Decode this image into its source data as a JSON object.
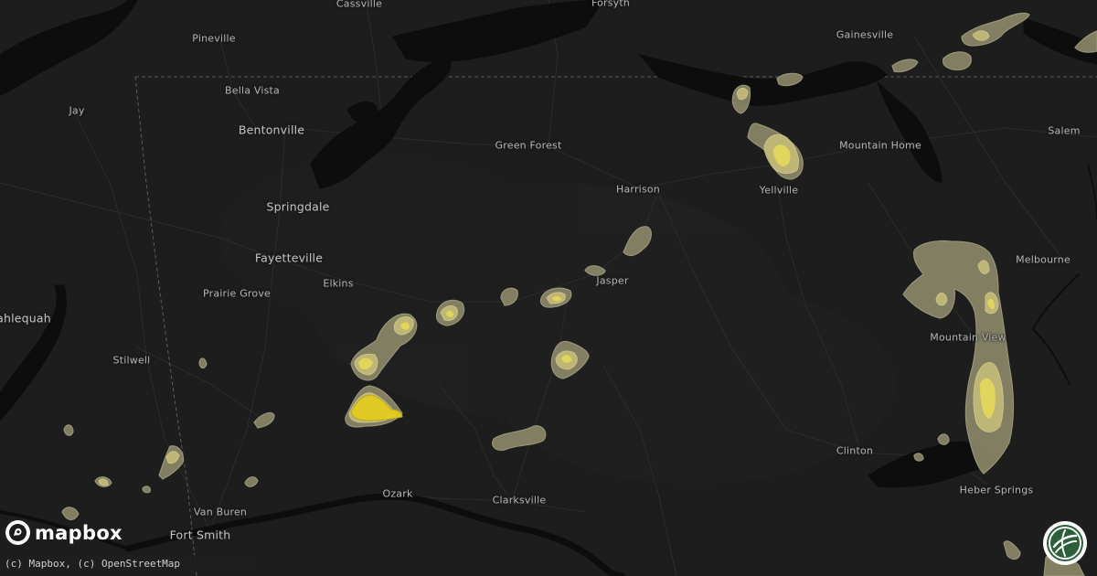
{
  "map": {
    "brand": "mapbox",
    "attribution": "(c) Mapbox, (c) OpenStreetMap",
    "colors": {
      "background": "#1d1d1d",
      "water": "#0c0c0c",
      "roads": "#2b2b2b",
      "border": "#5a5a5a",
      "hail_outer": "#8f8c6c",
      "hail_mid": "#c9c07a",
      "hail_inner": "#e7d85c",
      "hail_core": "#e6cf1e"
    },
    "cities": [
      {
        "id": "cassville",
        "name": "Cassville"
      },
      {
        "id": "forsyth",
        "name": "Forsyth"
      },
      {
        "id": "gainesville",
        "name": "Gainesville"
      },
      {
        "id": "pineville",
        "name": "Pineville"
      },
      {
        "id": "bella-vista",
        "name": "Bella Vista"
      },
      {
        "id": "bentonville",
        "name": "Bentonville"
      },
      {
        "id": "jay",
        "name": "Jay"
      },
      {
        "id": "green-forest",
        "name": "Green Forest"
      },
      {
        "id": "harrison",
        "name": "Harrison"
      },
      {
        "id": "mountain-home",
        "name": "Mountain Home"
      },
      {
        "id": "yellville",
        "name": "Yellville"
      },
      {
        "id": "salem",
        "name": "Salem"
      },
      {
        "id": "springdale",
        "name": "Springdale"
      },
      {
        "id": "fayetteville",
        "name": "Fayetteville"
      },
      {
        "id": "elkins",
        "name": "Elkins"
      },
      {
        "id": "jasper",
        "name": "Jasper"
      },
      {
        "id": "melbourne",
        "name": "Melbourne"
      },
      {
        "id": "prairie-grove",
        "name": "Prairie Grove"
      },
      {
        "id": "tahlequah",
        "name": "ahlequah"
      },
      {
        "id": "mountain-view",
        "name": "Mountain View"
      },
      {
        "id": "stilwell",
        "name": "Stilwell"
      },
      {
        "id": "clinton",
        "name": "Clinton"
      },
      {
        "id": "heber-springs",
        "name": "Heber Springs"
      },
      {
        "id": "ozark",
        "name": "Ozark"
      },
      {
        "id": "clarksville",
        "name": "Clarksville"
      },
      {
        "id": "van-buren",
        "name": "Van Buren"
      },
      {
        "id": "fort-smith",
        "name": "Fort Smith"
      }
    ],
    "icons": {
      "brand_mark": "mapbox-logo-icon",
      "badge": "site-badge-icon"
    }
  }
}
